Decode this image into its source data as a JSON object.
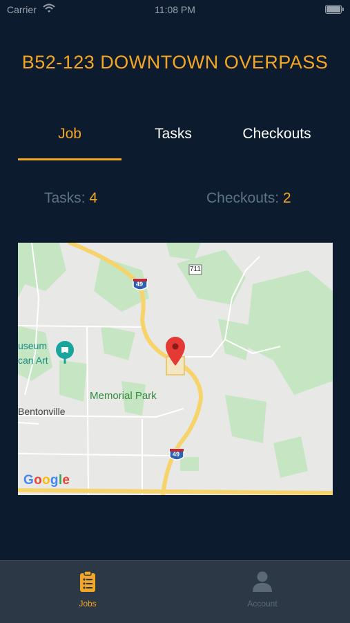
{
  "status_bar": {
    "carrier": "Carrier",
    "time": "11:08 PM"
  },
  "job": {
    "title": "B52-123 DOWNTOWN OVERPASS"
  },
  "tabs": [
    {
      "label": "Job",
      "active": true
    },
    {
      "label": "Tasks",
      "active": false
    },
    {
      "label": "Checkouts",
      "active": false
    }
  ],
  "counts": {
    "tasks_label": "Tasks:",
    "tasks_value": "4",
    "checkouts_label": "Checkouts:",
    "checkouts_value": "2"
  },
  "map": {
    "labels": {
      "museum_line1": "useum",
      "museum_line2": "can Art",
      "park": "Memorial Park",
      "city": "Bentonville",
      "route_711": "711",
      "interstate_49": "49"
    },
    "attribution": "Google"
  },
  "tab_bar": {
    "items": [
      {
        "label": "Jobs",
        "icon": "clipboard-list-icon",
        "active": true
      },
      {
        "label": "Account",
        "icon": "person-icon",
        "active": false
      }
    ]
  },
  "colors": {
    "accent": "#f5a623",
    "background": "#0c1c2e",
    "muted": "#5d7387",
    "tab_bar": "#2c3845"
  }
}
